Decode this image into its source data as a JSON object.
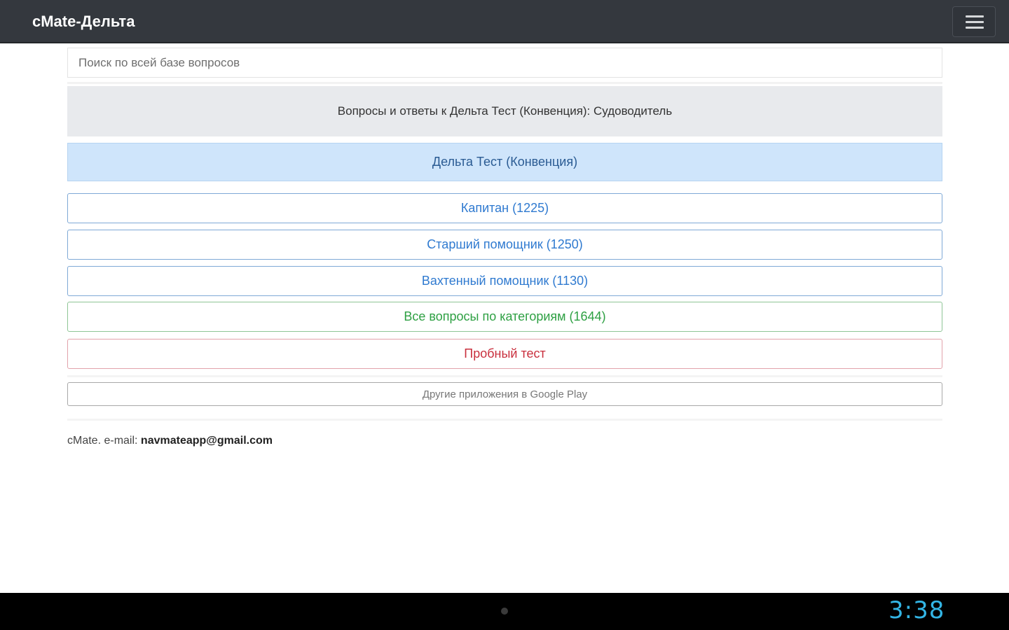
{
  "app": {
    "title": "cMate-Дельта"
  },
  "search": {
    "placeholder": "Поиск по всей базе вопросов"
  },
  "header": {
    "text": "Вопросы и ответы к Дельта Тест (Конвенция): Судоводитель"
  },
  "selected": {
    "label": "Дельта Тест (Конвенция)"
  },
  "buttons": [
    {
      "label": "Капитан (1225)",
      "color": "#2f7ad0"
    },
    {
      "label": "Старший помощник (1250)",
      "color": "#2f7ad0"
    },
    {
      "label": "Вахтенный помощник (1130)",
      "color": "#2f7ad0"
    },
    {
      "label": "Все вопросы по категориям (1644)",
      "color": "#2ea043"
    },
    {
      "label": "Пробный тест",
      "color": "#c9303e"
    }
  ],
  "other_apps": {
    "label": "Другие приложения в Google Play"
  },
  "footer": {
    "prefix": "cMate. e-mail: ",
    "email": "navmateapp@gmail.com"
  },
  "system": {
    "time": "3:38",
    "icons": [
      "back-icon",
      "home-icon",
      "recent-apps-icon",
      "storage-icon",
      "signal-icon",
      "battery-icon"
    ],
    "accent": "#33b5e5"
  }
}
